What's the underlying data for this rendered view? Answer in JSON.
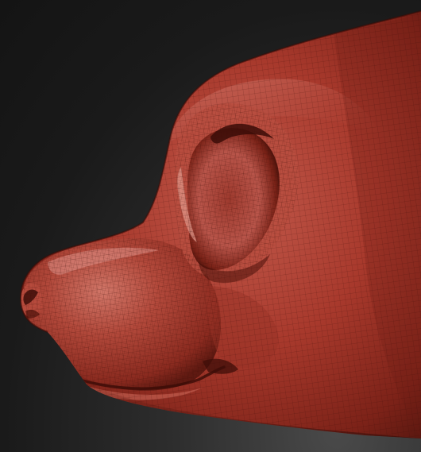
{
  "viewport": {
    "background_color": "#1e1e1e",
    "subject": "sculpted-head-model"
  },
  "model": {
    "base_color": "#a8392c",
    "highlight_color": "#d4776a",
    "shadow_color": "#5a1a12",
    "wireframe_visible": true
  }
}
